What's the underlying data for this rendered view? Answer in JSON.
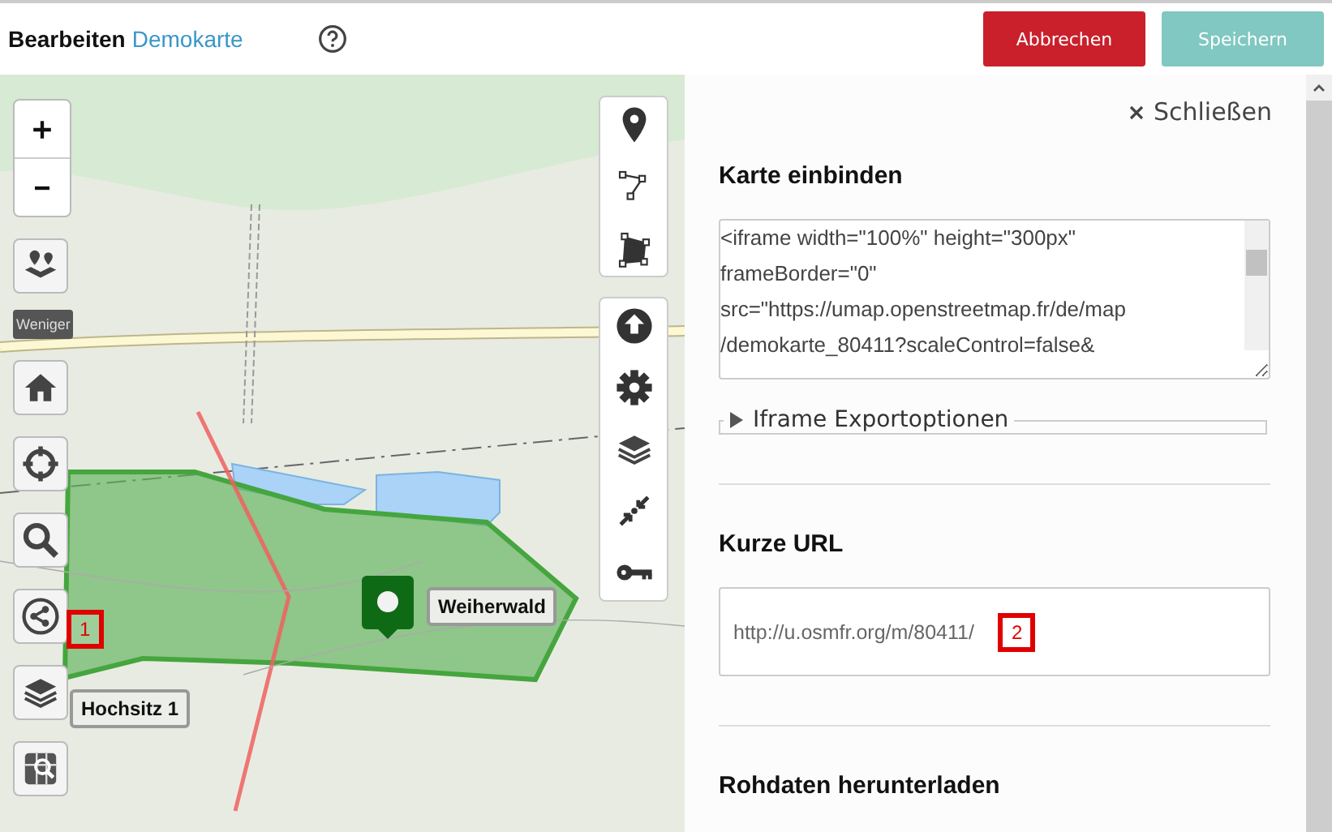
{
  "header": {
    "title": "Bearbeiten",
    "map_name": "Demokarte",
    "buttons": [
      {
        "label": "Abbrechen",
        "kind": "danger",
        "disabled": false
      },
      {
        "label": "Speichern",
        "kind": "primary",
        "disabled": true
      }
    ]
  },
  "map": {
    "toggle_label": "Weniger",
    "marker_label": "Weiherwald",
    "tooltip": "Hochsitz 1",
    "callout": "1"
  },
  "panel": {
    "close_label": "Schließen",
    "sections": [
      {
        "kind": "code",
        "title": "Karte einbinden",
        "value": "<iframe width=\"100%\" height=\"300px\"\nframeBorder=\"0\"\nsrc=\"https://umap.openstreetmap.fr/de/map\n/demokarte_80411?scaleControl=false&",
        "options_label": "Iframe Exportoptionen",
        "expanded": false
      },
      {
        "kind": "url",
        "title": "Kurze URL",
        "value": "http://u.osmfr.org/m/80411/",
        "callout": "2"
      },
      {
        "kind": "heading",
        "title": "Rohdaten herunterladen"
      }
    ]
  }
}
